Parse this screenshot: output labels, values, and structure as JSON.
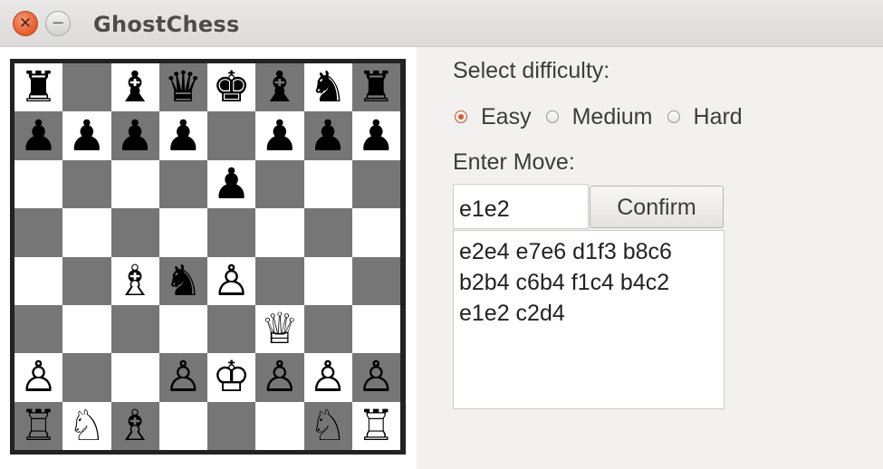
{
  "window": {
    "title": "GhostChess",
    "close_symbol": "✕",
    "minimize_symbol": "−"
  },
  "board": {
    "dark_color": "#767676",
    "light_color": "#ffffff",
    "squares": [
      [
        "♜",
        "",
        "♝",
        "♛",
        "♚",
        "♝",
        "♞",
        "♜"
      ],
      [
        "♟",
        "♟",
        "♟",
        "♟",
        "",
        "♟",
        "♟",
        "♟"
      ],
      [
        "",
        "",
        "",
        "",
        "♟",
        "",
        "",
        ""
      ],
      [
        "",
        "",
        "",
        "",
        "",
        "",
        "",
        ""
      ],
      [
        "",
        "",
        "♗",
        "♞",
        "♙",
        "",
        "",
        ""
      ],
      [
        "",
        "",
        "",
        "",
        "",
        "♕",
        "",
        ""
      ],
      [
        "♙",
        "",
        "",
        "♙",
        "♔",
        "♙",
        "♙",
        "♙"
      ],
      [
        "♖",
        "♘",
        "♗",
        "",
        "",
        "",
        "♘",
        "♖"
      ]
    ]
  },
  "difficulty": {
    "label": "Select difficulty:",
    "options": [
      "Easy",
      "Medium",
      "Hard"
    ],
    "selected": "Easy"
  },
  "move": {
    "label": "Enter Move:",
    "input_value": "e1e2",
    "confirm_label": "Confirm"
  },
  "history": {
    "text": "e2e4 e7e6 d1f3 b8c6\nb2b4 c6b4 f1c4 b4c2\ne1e2 c2d4"
  }
}
